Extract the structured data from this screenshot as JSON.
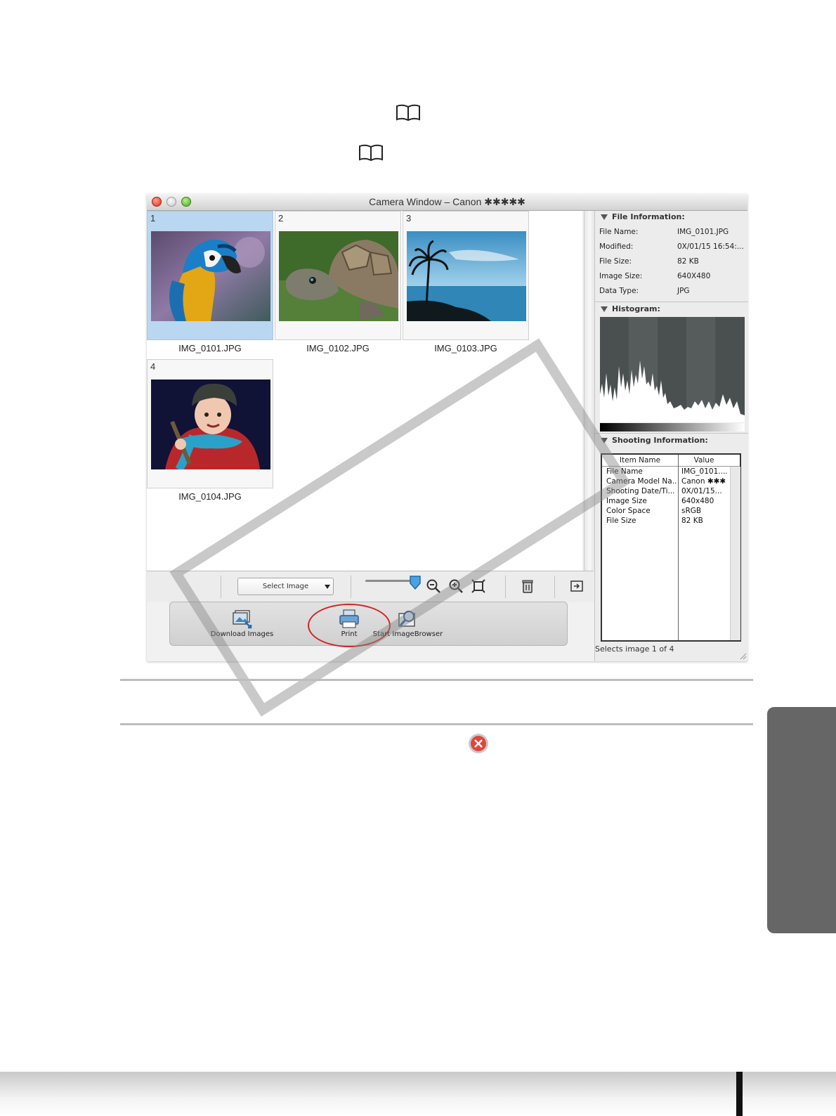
{
  "window": {
    "title": "Camera Window – Canon ✱✱✱✱✱"
  },
  "thumbnails": [
    {
      "number": "1",
      "filename": "IMG_0101.JPG",
      "subject": "parrot"
    },
    {
      "number": "2",
      "filename": "IMG_0102.JPG",
      "subject": "tortoise"
    },
    {
      "number": "3",
      "filename": "IMG_0103.JPG",
      "subject": "seascape"
    },
    {
      "number": "4",
      "filename": "IMG_0104.JPG",
      "subject": "child"
    }
  ],
  "toolbar": {
    "select_label": "Select Image"
  },
  "actions": {
    "download": "Download Images",
    "print": "Print",
    "imagebrowser": "Start ImageBrowser"
  },
  "file_info": {
    "heading": "File Information:",
    "rows": [
      {
        "key": "File Name:",
        "value": "IMG_0101.JPG"
      },
      {
        "key": "Modified:",
        "value": "0X/01/15 16:54:..."
      },
      {
        "key": "File Size:",
        "value": "82 KB"
      },
      {
        "key": "Image Size:",
        "value": "640X480"
      },
      {
        "key": "Data Type:",
        "value": "JPG"
      }
    ]
  },
  "histogram": {
    "heading": "Histogram:"
  },
  "shooting_info": {
    "heading": "Shooting Information:",
    "col_item": "Item Name",
    "col_value": "Value",
    "rows": [
      {
        "item": "File Name",
        "value": "IMG_0101...."
      },
      {
        "item": "Camera Model Na...",
        "value": "Canon ✱✱✱"
      },
      {
        "item": "Shooting Date/Ti...",
        "value": "0X/01/15..."
      },
      {
        "item": "Image Size",
        "value": "640x480"
      },
      {
        "item": "Color Space",
        "value": "sRGB"
      },
      {
        "item": "File Size",
        "value": "82 KB"
      }
    ]
  },
  "status": "Selects image 1 of 4",
  "colors": {
    "selection": "#b9d7f1",
    "highlight_circle": "#d42323",
    "side_tab": "#666666"
  }
}
